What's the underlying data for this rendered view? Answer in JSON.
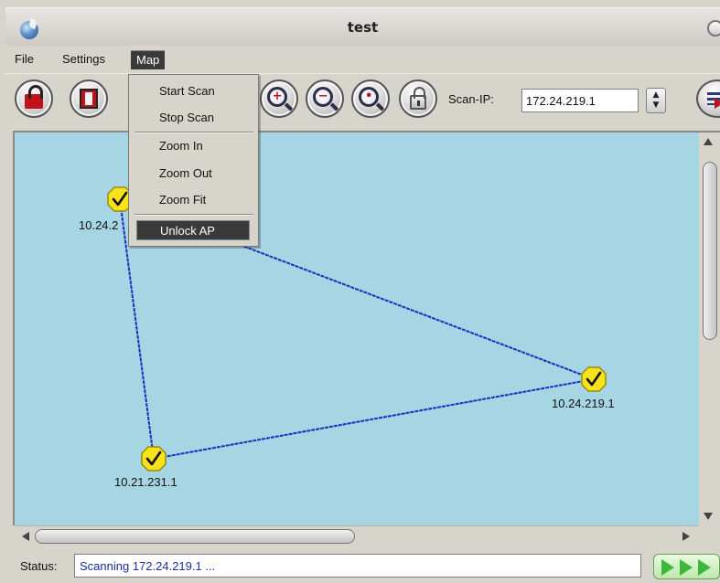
{
  "window": {
    "title": "test"
  },
  "menubar": {
    "items": [
      {
        "label": "File"
      },
      {
        "label": "Settings"
      },
      {
        "label": "Map",
        "active": true
      }
    ]
  },
  "map_menu": {
    "items": [
      {
        "label": "Start Scan"
      },
      {
        "label": "Stop Scan"
      },
      {
        "separator": true
      },
      {
        "label": "Zoom In"
      },
      {
        "label": "Zoom Out"
      },
      {
        "label": "Zoom Fit"
      },
      {
        "separator": true
      },
      {
        "label": "Unlock AP",
        "selected": true
      }
    ]
  },
  "toolbar": {
    "buttons": [
      {
        "icon": "unlock-red-icon"
      },
      {
        "icon": "save-red-icon"
      },
      {
        "icon": "zoom-in-icon"
      },
      {
        "icon": "zoom-out-icon"
      },
      {
        "icon": "zoom-fit-icon"
      },
      {
        "icon": "padlock-icon"
      },
      {
        "icon": "list-arrow-icon"
      }
    ],
    "scan_ip_label": "Scan-IP:",
    "scan_ip_value": "172.24.219.1"
  },
  "map": {
    "nodes": [
      {
        "id": "n1",
        "label": "10.24.2",
        "icon": "check-node-icon"
      },
      {
        "id": "n2",
        "label": "10.24.219.1",
        "icon": "check-node-icon"
      },
      {
        "id": "n3",
        "label": "10.21.231.1",
        "icon": "check-node-icon"
      }
    ],
    "links": [
      {
        "from": "n1",
        "to": "n2"
      },
      {
        "from": "n1",
        "to": "n3"
      },
      {
        "from": "n3",
        "to": "n2"
      }
    ],
    "background_color": "#a6d5e3",
    "link_color": "#1a2fc0",
    "node_color": "#f7e21b"
  },
  "status": {
    "label": "Status:",
    "text": "Scanning 172.24.219.1 ..."
  }
}
